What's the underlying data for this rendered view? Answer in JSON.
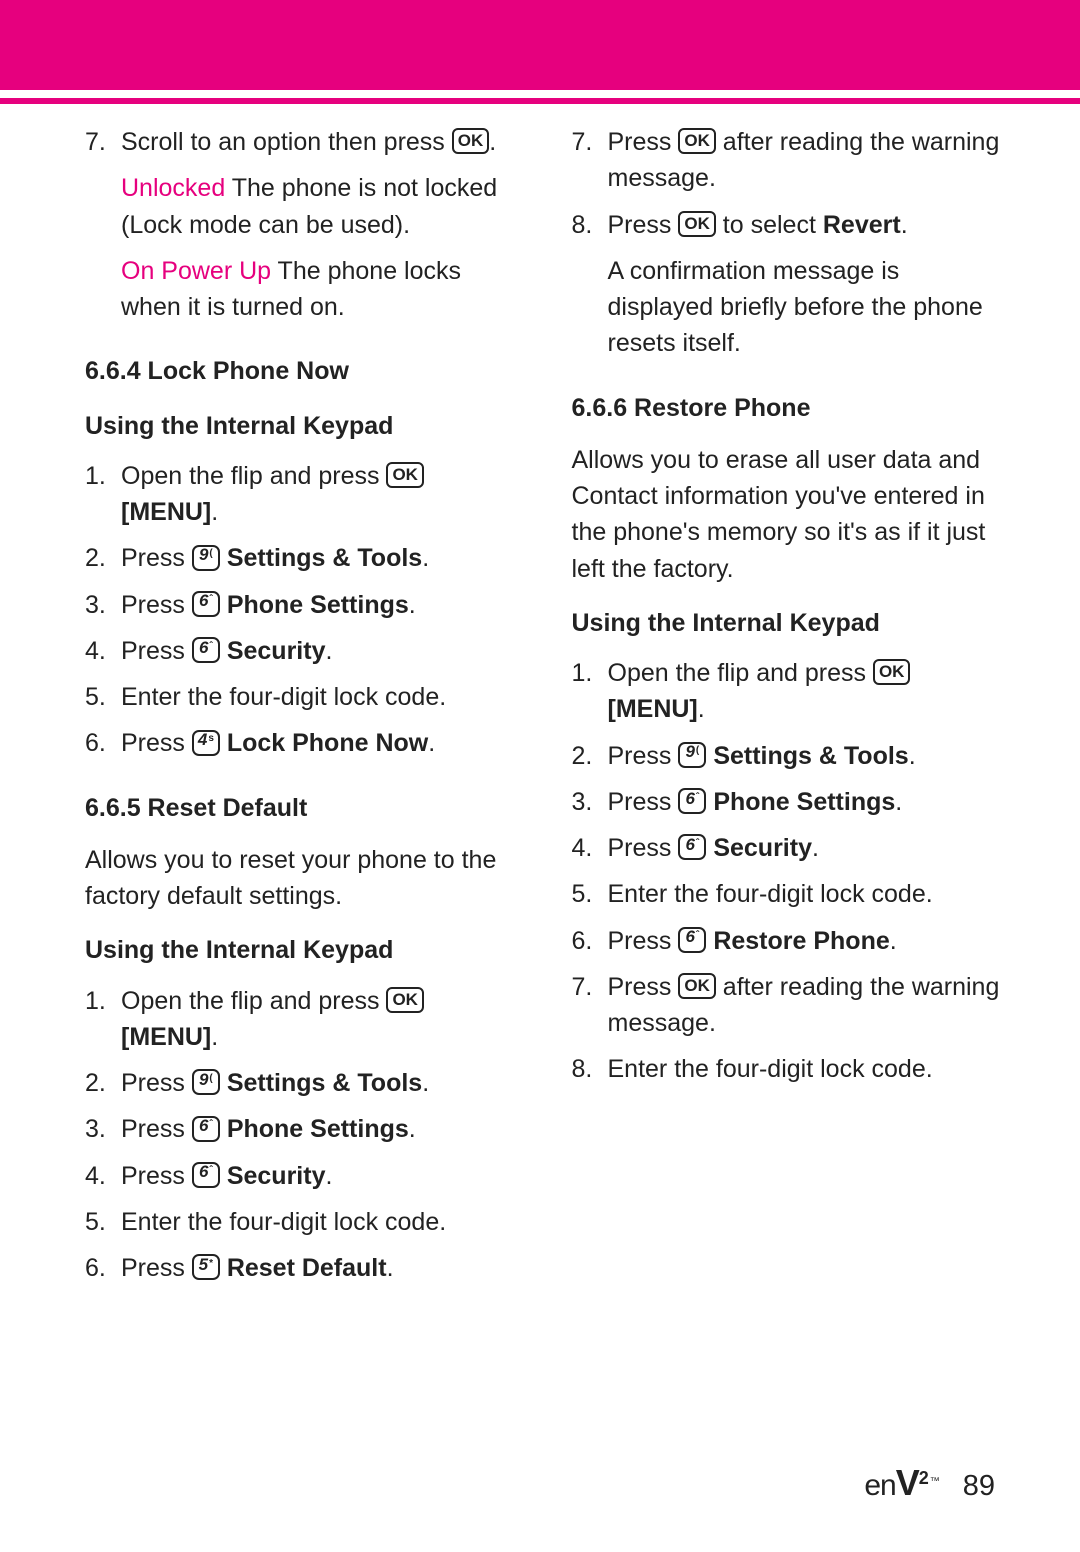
{
  "colors": {
    "accent": "#e6007e"
  },
  "left": {
    "intro": {
      "s7_num": "7.",
      "s7_a": "Scroll to an option then press ",
      "s7_ok": "OK",
      "s7_b": ".",
      "unlocked_label": "Unlocked",
      "unlocked_rest": "  The phone is not locked (Lock mode can be used).",
      "onpowerup_label": "On Power Up",
      "onpowerup_rest": "  The phone locks when it is turned on."
    },
    "h664": "6.6.4 Lock Phone Now",
    "using1": "Using the Internal Keypad",
    "sec664": {
      "s1n": "1.",
      "s1a": "Open the flip and press ",
      "ok": "OK",
      "s1b": "[MENU]",
      "s1c": ".",
      "s2n": "2.",
      "s2a": "Press ",
      "k9": "9",
      "k9s": "(",
      "s2b": "Settings & Tools",
      "s2c": ".",
      "s3n": "3.",
      "s3a": "Press ",
      "k6": "6",
      "k6s": "ˆ",
      "s3b": "Phone Settings",
      "s3c": ".",
      "s4n": "4.",
      "s4a": "Press ",
      "s4b": "Security",
      "s4c": ".",
      "s5n": "5.",
      "s5a": "Enter the four-digit lock code.",
      "s6n": "6.",
      "s6a": "Press ",
      "k4": "4",
      "k4s": "s",
      "s6b": "Lock Phone Now",
      "s6c": "."
    },
    "h665": "6.6.5 Reset Default",
    "desc665": "Allows you to reset your phone to the factory default settings.",
    "using2": "Using the Internal Keypad",
    "sec665": {
      "s1n": "1.",
      "s1a": "Open the flip and press ",
      "ok": "OK",
      "s1b": "[MENU]",
      "s1c": ".",
      "s2n": "2.",
      "s2a": "Press ",
      "k9": "9",
      "k9s": "(",
      "s2b": "Settings & Tools",
      "s2c": ".",
      "s3n": "3.",
      "s3a": "Press ",
      "k6": "6",
      "k6s": "ˆ",
      "s3b": "Phone Settings",
      "s3c": ".",
      "s4n": "4.",
      "s4a": "Press ",
      "s4b": "Security",
      "s4c": ".",
      "s5n": "5.",
      "s5a": "Enter the four-digit lock code.",
      "s6n": "6.",
      "s6a": "Press ",
      "k5": "5",
      "k5s": "*",
      "s6b": "Reset Default",
      "s6c": "."
    }
  },
  "right": {
    "cont665": {
      "s7n": "7.",
      "s7a": "Press ",
      "ok": "OK",
      "s7b": " after reading the warning message.",
      "s8n": "8.",
      "s8a": "Press ",
      "s8b": " to select ",
      "s8c": "Revert",
      "s8d": ".",
      "conf": "A confirmation message is displayed briefly before the phone resets itself."
    },
    "h666": "6.6.6 Restore Phone",
    "desc666": "Allows you to erase all user data and Contact information you've entered in the phone's memory so it's as if it just left the factory.",
    "using": "Using the Internal Keypad",
    "sec666": {
      "s1n": "1.",
      "s1a": "Open the flip and press ",
      "ok": "OK",
      "s1b": "[MENU]",
      "s1c": ".",
      "s2n": "2.",
      "s2a": "Press ",
      "k9": "9",
      "k9s": "(",
      "s2b": "Settings & Tools",
      "s2c": ".",
      "s3n": "3.",
      "s3a": "Press ",
      "k6": "6",
      "k6s": "ˆ",
      "s3b": "Phone Settings",
      "s3c": ".",
      "s4n": "4.",
      "s4a": "Press ",
      "s4b": "Security",
      "s4c": ".",
      "s5n": "5.",
      "s5a": "Enter the four-digit lock code.",
      "s6n": "6.",
      "s6a": "Press ",
      "s6b": "Restore Phone",
      "s6c": ".",
      "s7n": "7.",
      "s7a": "Press ",
      "s7b": " after reading the warning message.",
      "s8n": "8.",
      "s8a": "Enter the four-digit lock code."
    }
  },
  "footer": {
    "logo_e": "e",
    "logo_n": "n",
    "logo_V": "V",
    "logo_two": "2",
    "logo_tm": "™",
    "page": "89"
  }
}
